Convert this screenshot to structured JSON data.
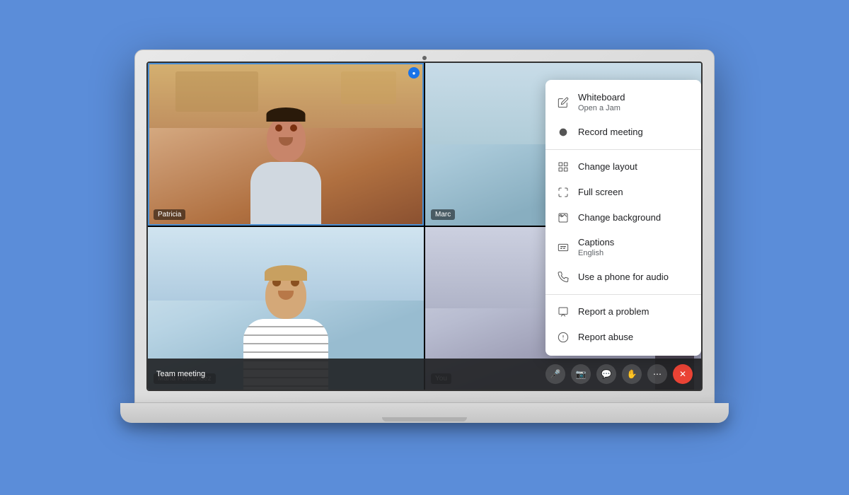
{
  "background_color": "#5b8dd9",
  "laptop": {
    "camera_label": "webcam"
  },
  "meeting": {
    "title": "Team meeting",
    "participants": [
      {
        "name": "Patricia",
        "position": "top-left"
      },
      {
        "name": "Marc",
        "position": "top-right"
      },
      {
        "name": "Maria Fernandez",
        "position": "bottom-left"
      },
      {
        "name": "You",
        "position": "bottom-right"
      }
    ]
  },
  "bar_controls": [
    {
      "label": "🎤",
      "name": "microphone"
    },
    {
      "label": "📷",
      "name": "camera"
    },
    {
      "label": "💬",
      "name": "chat"
    },
    {
      "label": "🖐",
      "name": "hand"
    },
    {
      "label": "⋯",
      "name": "more"
    },
    {
      "label": "✕",
      "name": "end-call",
      "style": "red"
    }
  ],
  "context_menu": {
    "items": [
      {
        "id": "whiteboard",
        "label": "Whiteboard",
        "sublabel": "Open a Jam",
        "icon": "edit"
      },
      {
        "id": "record",
        "label": "Record meeting",
        "sublabel": "",
        "icon": "circle"
      },
      {
        "id": "divider1"
      },
      {
        "id": "layout",
        "label": "Change layout",
        "sublabel": "",
        "icon": "grid"
      },
      {
        "id": "fullscreen",
        "label": "Full screen",
        "sublabel": "",
        "icon": "maximize"
      },
      {
        "id": "background",
        "label": "Change background",
        "sublabel": "",
        "icon": "image"
      },
      {
        "id": "captions",
        "label": "Captions",
        "sublabel": "English",
        "icon": "cc"
      },
      {
        "id": "phone",
        "label": "Use a phone for audio",
        "sublabel": "",
        "icon": "phone"
      },
      {
        "id": "divider2"
      },
      {
        "id": "report-problem",
        "label": "Report a problem",
        "sublabel": "",
        "icon": "flag"
      },
      {
        "id": "report-abuse",
        "label": "Report abuse",
        "sublabel": "",
        "icon": "info"
      }
    ]
  }
}
